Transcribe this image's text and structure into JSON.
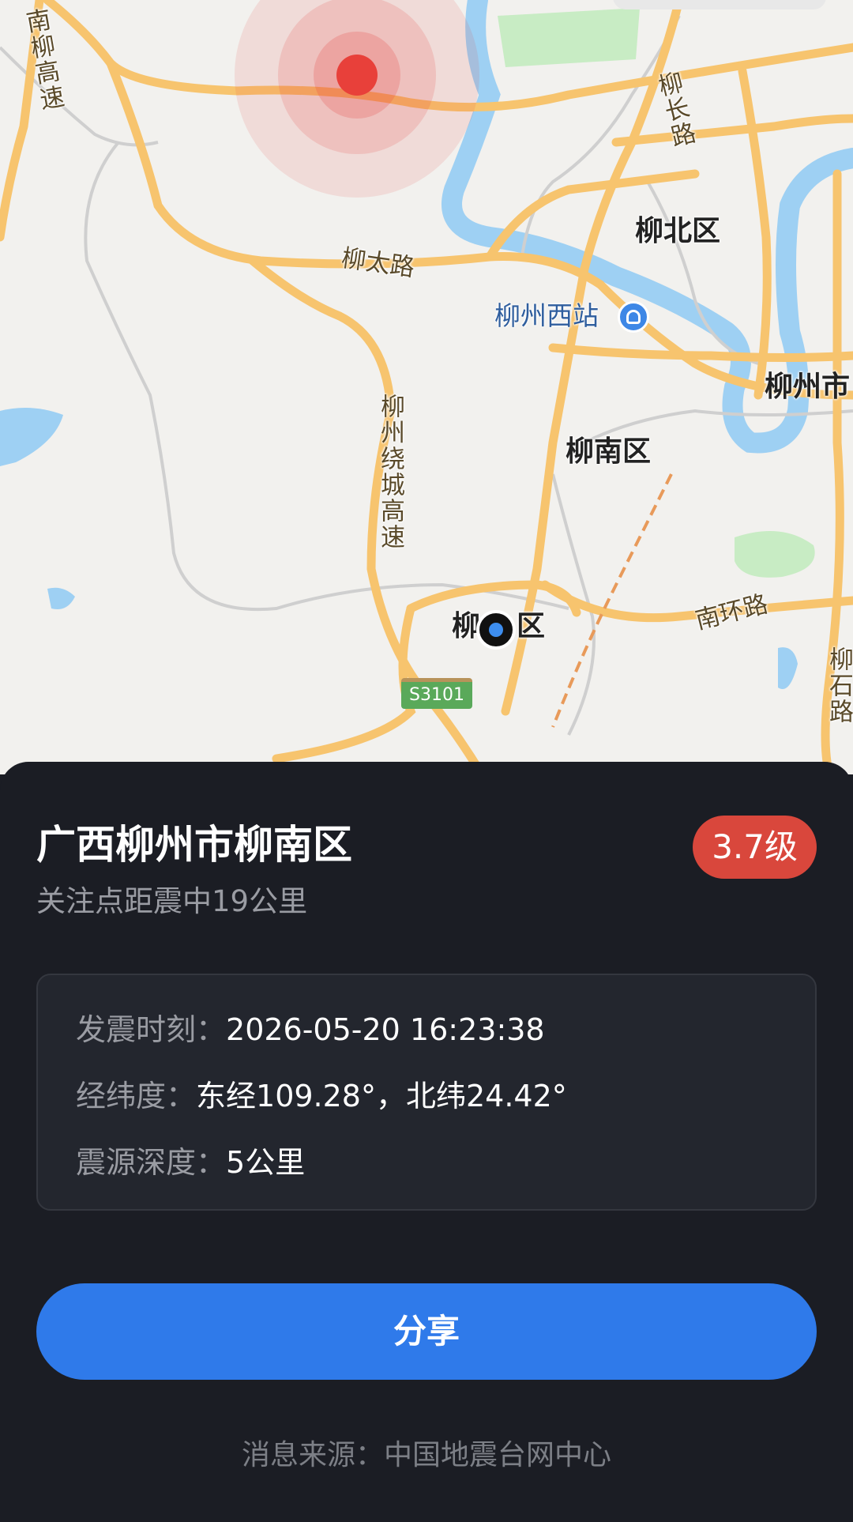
{
  "map": {
    "labels": {
      "nanliu_highway": "南柳高速",
      "liuchang_road": "柳长路",
      "liubei_district": "柳北区",
      "liutai_road": "柳太路",
      "liuzhou_west_station": "柳州西站",
      "liuzhou_city": "柳州市",
      "ring_highway": "柳州绕城高速",
      "liunan_district": "柳南区",
      "pin_district_left": "柳",
      "pin_district_right": "区",
      "nanhuan_road": "南环路",
      "liushi_road": "柳石路",
      "shield_s3101": "S3101"
    },
    "epicenter_color": "#e8403a",
    "pin_color": "#3d8ef0"
  },
  "quake": {
    "title": "广西柳州市柳南区",
    "distance": "关注点距震中19公里",
    "magnitude": "3.7级",
    "magnitude_color": "#d9473c",
    "time_label": "发震时刻：",
    "time_value": "2026-05-20 16:23:38",
    "coord_label": "经纬度：",
    "coord_value": "东经109.28°，北纬24.42°",
    "depth_label": "震源深度：",
    "depth_value": "5公里"
  },
  "actions": {
    "share_label": "分享",
    "share_color": "#2f7aea"
  },
  "footer": {
    "source": "消息来源：中国地震台网中心"
  }
}
